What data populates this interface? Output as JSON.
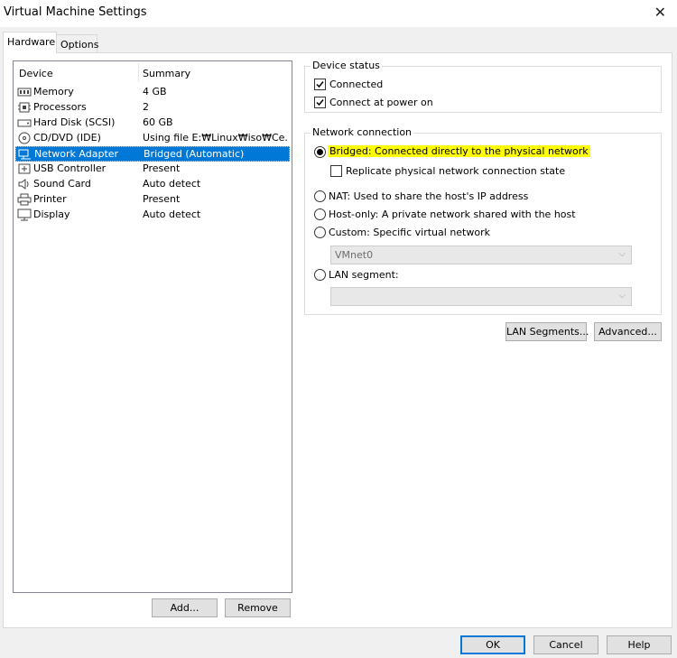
{
  "window": {
    "title": "Virtual Machine Settings",
    "close_glyph": "✕"
  },
  "tabs": [
    {
      "label": "Hardware",
      "active": true
    },
    {
      "label": "Options",
      "active": false
    }
  ],
  "device_list": {
    "col_device": "Device",
    "col_summary": "Summary",
    "items": [
      {
        "name": "Memory",
        "summary": "4 GB",
        "icon": "memory-icon"
      },
      {
        "name": "Processors",
        "summary": "2",
        "icon": "processor-icon"
      },
      {
        "name": "Hard Disk (SCSI)",
        "summary": "60 GB",
        "icon": "hard-disk-icon"
      },
      {
        "name": "CD/DVD (IDE)",
        "summary": "Using file E:₩Linux₩iso₩Ce...",
        "icon": "cd-dvd-icon"
      },
      {
        "name": "Network Adapter",
        "summary": "Bridged (Automatic)",
        "icon": "network-adapter-icon",
        "selected": true
      },
      {
        "name": "USB Controller",
        "summary": "Present",
        "icon": "usb-icon"
      },
      {
        "name": "Sound Card",
        "summary": "Auto detect",
        "icon": "speaker-icon"
      },
      {
        "name": "Printer",
        "summary": "Present",
        "icon": "printer-icon"
      },
      {
        "name": "Display",
        "summary": "Auto detect",
        "icon": "monitor-icon"
      }
    ]
  },
  "list_buttons": {
    "add": "Add...",
    "remove": "Remove"
  },
  "device_status": {
    "title": "Device status",
    "connected": {
      "label": "Connected",
      "checked": true
    },
    "connect_at_power_on": {
      "label": "Connect at power on",
      "checked": true
    }
  },
  "network_connection": {
    "title": "Network connection",
    "bridged": {
      "label": "Bridged: Connected directly to the physical network",
      "selected": true
    },
    "replicate": {
      "label": "Replicate physical network connection state",
      "checked": false
    },
    "nat": {
      "label": "NAT: Used to share the host's IP address"
    },
    "host_only": {
      "label": "Host-only: A private network shared with the host"
    },
    "custom": {
      "label": "Custom: Specific virtual network",
      "select_value": "VMnet0"
    },
    "lan_segment": {
      "label": "LAN segment:",
      "select_value": ""
    }
  },
  "network_buttons": {
    "lan_segments": "LAN Segments...",
    "advanced": "Advanced..."
  },
  "dialog_buttons": {
    "ok": "OK",
    "cancel": "Cancel",
    "help": "Help"
  },
  "colors": {
    "selection": "#0078d7",
    "highlight": "#ffff00"
  }
}
